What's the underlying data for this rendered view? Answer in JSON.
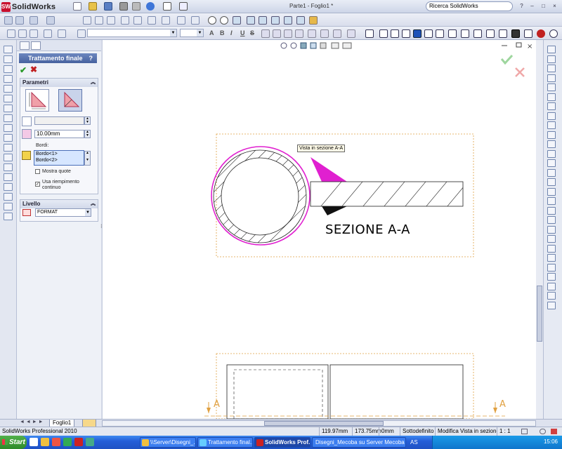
{
  "app": {
    "logo_text": "SolidWorks",
    "logo_mark": "SW",
    "document_title": "Parte1 - Foglio1 *"
  },
  "search": {
    "placeholder": "Ricerca SolidWorks"
  },
  "window_controls": [
    "?",
    "–",
    "□",
    "×"
  ],
  "format_combo": {
    "value": ""
  },
  "format_buttons": [
    "A",
    "B",
    "I",
    "U",
    "S"
  ],
  "feature_manager": {
    "title": "Trattamento finale",
    "help": "?",
    "groups": {
      "parametri": {
        "label": "Parametri",
        "distance_value": "10.00mm",
        "bordi_label": "Bordi:",
        "edges": [
          "Bordo<1>",
          "Bordo<2>"
        ],
        "options": [
          {
            "label": "Mostra quote",
            "checked": false
          },
          {
            "label": "Usa riempimento continuo",
            "checked": true
          }
        ]
      },
      "livello": {
        "label": "Livello",
        "value": "FORMAT"
      }
    }
  },
  "drawing": {
    "tooltip": "Vista in sezione A-A",
    "section_label": "SEZIONE A-A",
    "arrow_label_left": "A",
    "arrow_label_right": "A"
  },
  "sheet_tab": "Foglio1",
  "status": {
    "product": "SolidWorks Professional 2010",
    "x": "119.97mm",
    "y": "173.75mm",
    "z": "0mm",
    "state": "Sottodefinito",
    "mode": "Modifica Vista in sezione A-A",
    "scale": "1 : 1"
  },
  "taskbar": {
    "start": "Start",
    "tasks": [
      {
        "label": "\\\\Server\\Disegni_...",
        "active": false
      },
      {
        "label": "Trattamento final...",
        "active": false
      },
      {
        "label": "SolidWorks Prof...",
        "active": true
      },
      {
        "label": "Disegni_Mecoba su Server Mecoba (Server",
        "active": false
      }
    ],
    "tray_text": "AS",
    "clock": "15:06"
  },
  "colors": {
    "magenta": "#e020d0",
    "accent": "#47629f"
  }
}
